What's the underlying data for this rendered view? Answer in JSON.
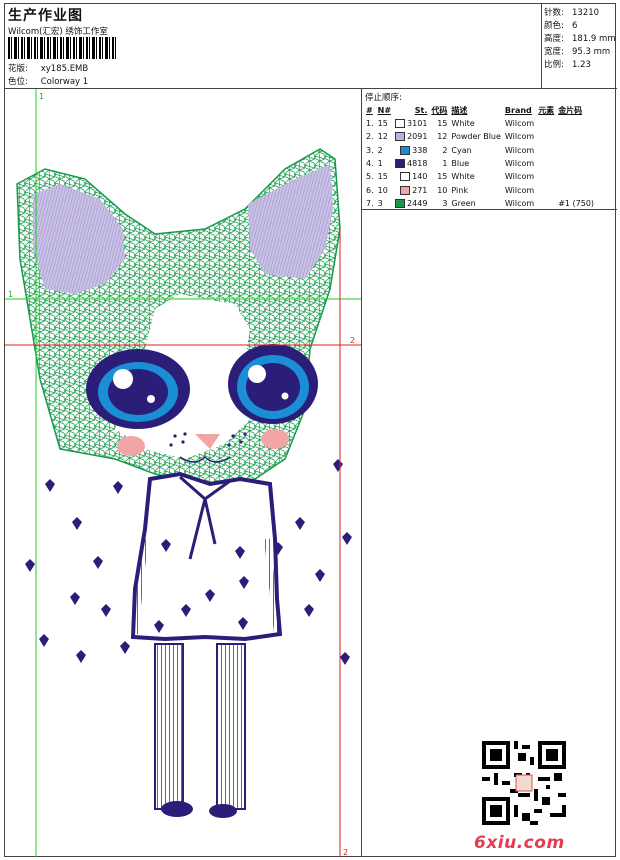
{
  "header": {
    "title": "生产作业图",
    "company": "Wilcom(汇宏) 绣饰工作室",
    "design_label": "花版:",
    "design_name": "xy185.EMB",
    "colorway_label": "色位:",
    "colorway_name": "Colorway 1"
  },
  "stats": [
    {
      "label": "针数:",
      "value": "13210"
    },
    {
      "label": "颜色:",
      "value": "6"
    },
    {
      "label": "高度:",
      "value": "181.9 mm"
    },
    {
      "label": "宽度:",
      "value": "95.3 mm"
    },
    {
      "label": "比例:",
      "value": "1.23"
    }
  ],
  "stop_sequence": {
    "title": "停止顺序:",
    "columns": [
      "#",
      "N#",
      "St.",
      "代码",
      "描述",
      "Brand",
      "元素",
      "金片码"
    ],
    "rows": [
      {
        "num": "1.",
        "n": "15",
        "color": "#ffffff",
        "st": "3101",
        "code": "15",
        "desc": "White",
        "brand": "Wilcom",
        "element": "",
        "sequin": ""
      },
      {
        "num": "2.",
        "n": "12",
        "color": "#b9b0dc",
        "st": "2091",
        "code": "12",
        "desc": "Powder Blue",
        "brand": "Wilcom",
        "element": "",
        "sequin": ""
      },
      {
        "num": "3.",
        "n": "2",
        "color": "#1a8fd6",
        "st": "338",
        "code": "2",
        "desc": "Cyan",
        "brand": "Wilcom",
        "element": "",
        "sequin": ""
      },
      {
        "num": "4.",
        "n": "1",
        "color": "#2a1e78",
        "st": "4818",
        "code": "1",
        "desc": "Blue",
        "brand": "Wilcom",
        "element": "",
        "sequin": ""
      },
      {
        "num": "5.",
        "n": "15",
        "color": "#ffffff",
        "st": "140",
        "code": "15",
        "desc": "White",
        "brand": "Wilcom",
        "element": "",
        "sequin": ""
      },
      {
        "num": "6.",
        "n": "10",
        "color": "#f2a5a5",
        "st": "271",
        "code": "10",
        "desc": "Pink",
        "brand": "Wilcom",
        "element": "",
        "sequin": ""
      },
      {
        "num": "7.",
        "n": "3",
        "color": "#169a4a",
        "st": "2449",
        "code": "3",
        "desc": "Green",
        "brand": "Wilcom",
        "element": "",
        "sequin": "#1 (750)"
      }
    ]
  },
  "guides": {
    "label_1": "1",
    "label_2": "2"
  },
  "watermark": "6xiu.com",
  "colors": {
    "green_guide": "#22cc22",
    "red_guide": "#dd2222",
    "navy": "#2a1e78",
    "lilac": "#b9b0dc",
    "green": "#169a4a",
    "cyan": "#1a8fd6",
    "pink": "#f2a5a5",
    "watermark": "#e33c52"
  }
}
